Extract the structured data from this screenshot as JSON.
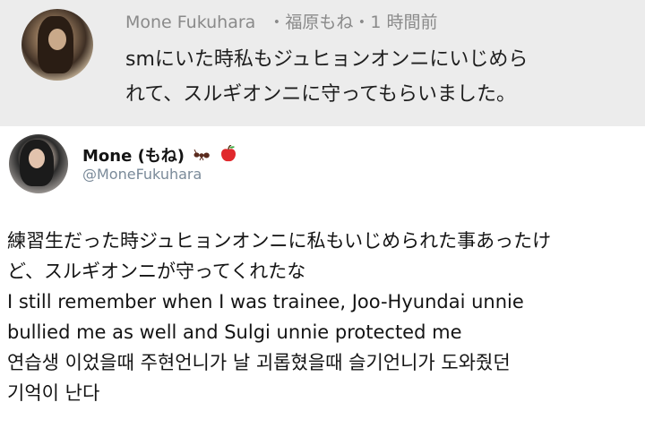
{
  "reply": {
    "author": "Mone Fukuhara",
    "meta": "・福原もね・1 時間前",
    "lines": [
      "smにいた時私もジュヒョンオンニにいじめら",
      "れて、スルギオンニに守ってもらいました。"
    ]
  },
  "tweet": {
    "display_name": "Mone (もね)",
    "name_icons": [
      "ant-icon",
      "apple-icon"
    ],
    "handle": "@MoneFukuhara",
    "lines": [
      "練習生だった時ジュヒョンオンニに私もいじめられた事あったけ",
      "ど、スルギオンニが守ってくれたな",
      "I still remember when I was trainee, Joo-Hyundai unnie",
      "bullied me as well and Sulgi unnie protected me",
      "연습생 이었을때 주현언니가 날 괴롭혔을때 슬기언니가 도와줬던",
      "기억이 난다"
    ]
  }
}
